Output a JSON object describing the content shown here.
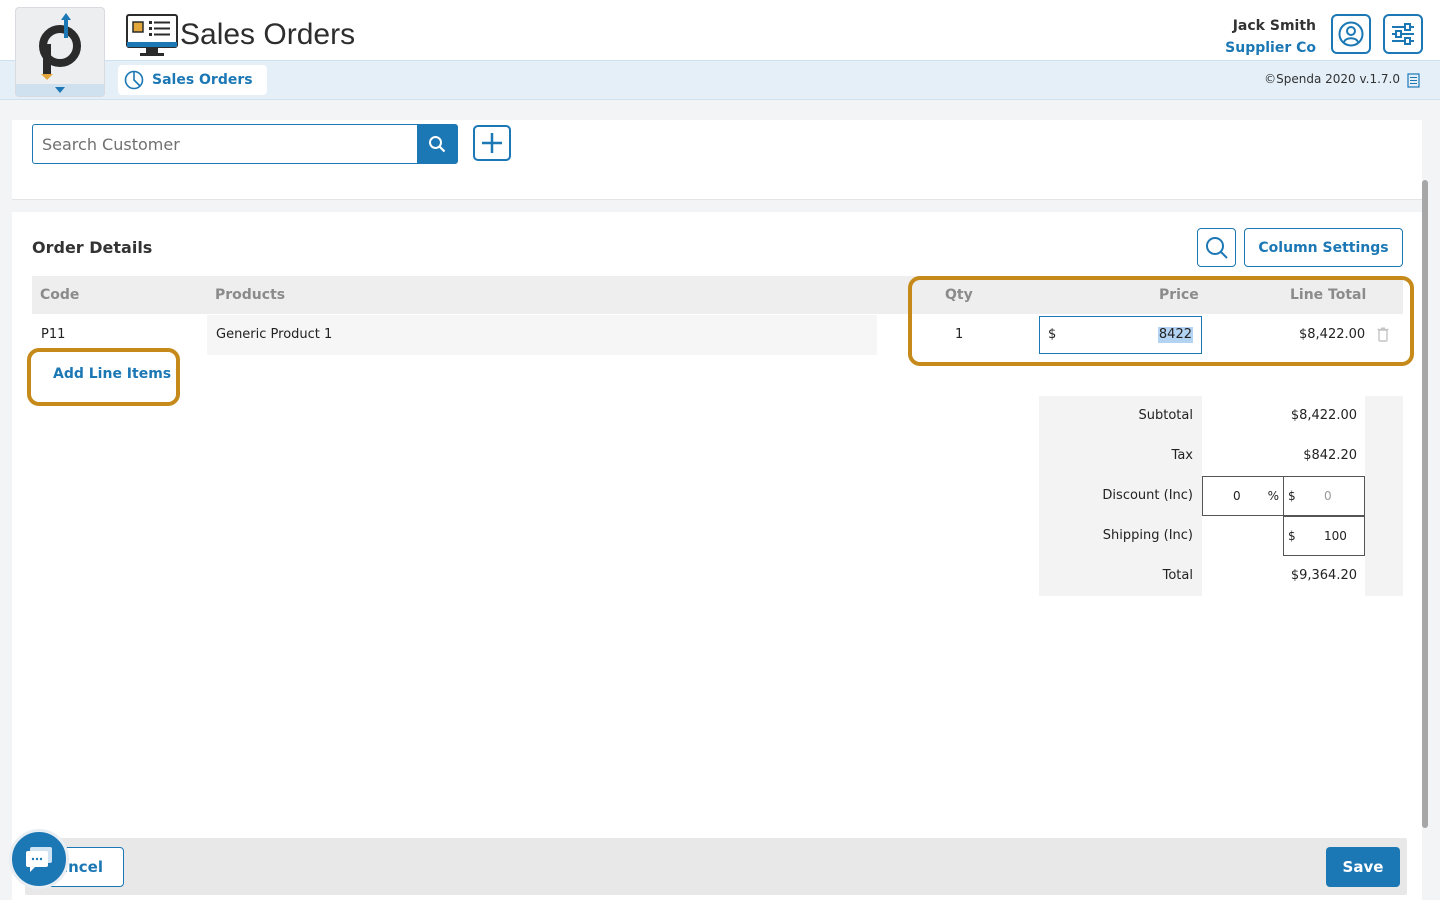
{
  "header": {
    "title": "Sales Orders",
    "breadcrumb_label": "Sales Orders",
    "user_name": "Jack Smith",
    "company": "Supplier Co",
    "copyright": "©Spenda 2020 v.1.7.0"
  },
  "customer_search": {
    "placeholder": "Search Customer"
  },
  "order": {
    "section_title": "Order Details",
    "column_settings_label": "Column Settings",
    "columns": {
      "code": "Code",
      "products": "Products",
      "qty": "Qty",
      "price": "Price",
      "line_total": "Line Total"
    },
    "rows": [
      {
        "code": "P11",
        "product": "Generic Product 1",
        "qty": "1",
        "price_currency": "$",
        "price": "8422",
        "line_total": "$8,422.00"
      }
    ],
    "add_line_items_label": "Add Line Items"
  },
  "totals": {
    "subtotal_label": "Subtotal",
    "subtotal": "$8,422.00",
    "tax_label": "Tax",
    "tax": "$842.20",
    "discount_label": "Discount (Inc)",
    "discount_percent": "0",
    "percent_symbol": "%",
    "discount_currency": "$",
    "discount_amount": "0",
    "shipping_label": "Shipping (Inc)",
    "shipping_currency": "$",
    "shipping_amount": "100",
    "total_label": "Total",
    "total": "$9,364.20"
  },
  "footer": {
    "cancel_label": "ancel",
    "save_label": "Save"
  },
  "colors": {
    "brand_blue": "#1c78b5",
    "highlight": "#c68a1a"
  },
  "icons": [
    "spenda-logo-icon",
    "sales-orders-app-icon",
    "pie-chart-icon",
    "user-circle-icon",
    "settings-sliders-icon",
    "document-icon",
    "search-icon",
    "plus-icon",
    "trash-icon",
    "chat-icon"
  ]
}
